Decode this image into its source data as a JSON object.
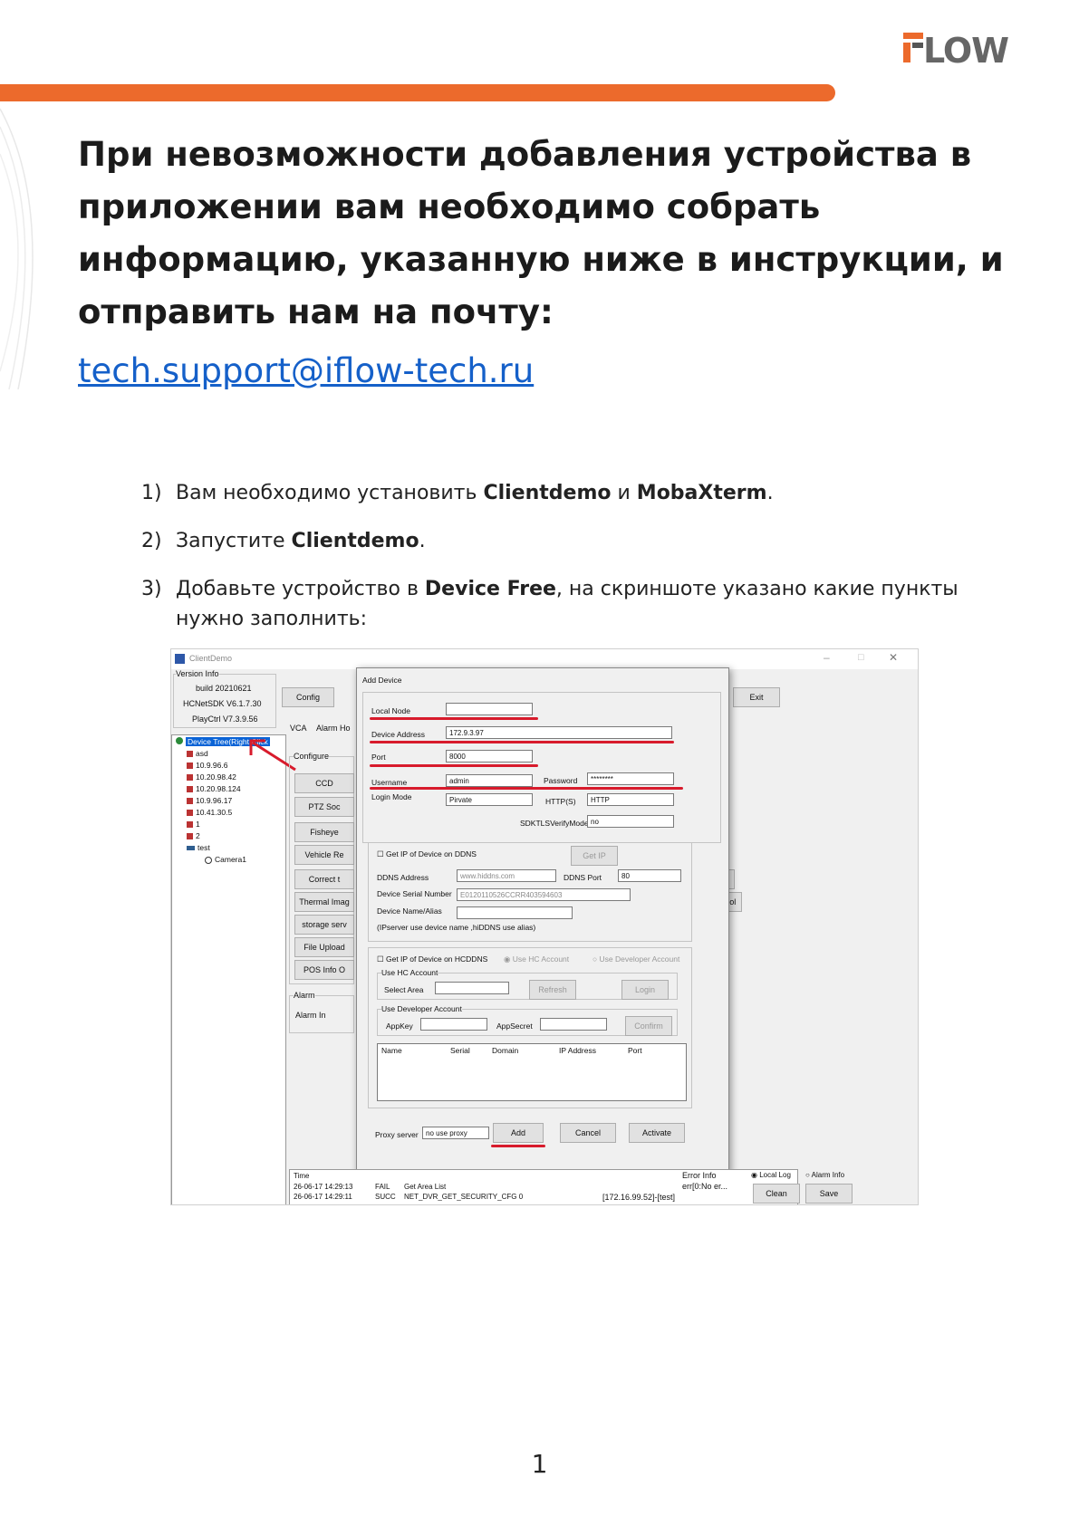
{
  "logo": {
    "text": "IFLOW",
    "color": "#ec6a2c"
  },
  "heading": "При невозможности добавления устройства в приложении вам необходимо собрать информацию, указанную ниже в инструкции, и отправить нам на почту:",
  "email": "tech.support@iflow-tech.ru",
  "steps": [
    {
      "num": "1)",
      "pre": "Вам необходимо установить ",
      "b1": "Clientdemo",
      "mid": " и ",
      "b2": "MobaXterm",
      "post": "."
    },
    {
      "num": "2)",
      "pre": "Запустите ",
      "b1": "Clientdemo",
      "post": "."
    },
    {
      "num": "3)",
      "pre": "Добавьте устройство в ",
      "b1": "Device Free",
      "post": ", на скриншоте указано какие пункты нужно заполнить:"
    }
  ],
  "page_number": "1",
  "screenshot": {
    "window_title": "ClientDemo",
    "version_info": {
      "label": "Version Info",
      "build": "build 20210621",
      "sdk": "HCNetSDK V6.1.7.30",
      "playctrl": "PlayCtrl V7.3.9.56"
    },
    "buttons": {
      "config": "Config",
      "exit": "Exit"
    },
    "tabs": [
      "VCA",
      "Alarm Ho"
    ],
    "tree": {
      "root": "Device Tree(Right Click",
      "items": [
        "asd",
        "10.9.96.6",
        "10.20.98.42",
        "10.20.98.124",
        "10.9.96.17",
        "10.41.30.5",
        "1",
        "2",
        "test"
      ],
      "camera": "Camera1"
    },
    "configure": {
      "label": "Configure",
      "buttons": [
        "CCD",
        "PTZ Soc",
        "Fisheye",
        "Vehicle Re",
        "Correct t",
        "Thermal Imag",
        "storage serv",
        "File Upload",
        "POS Info O"
      ]
    },
    "alarm": {
      "label": "Alarm",
      "alarm_in": "Alarm In"
    },
    "right_partial": [
      "on",
      "ocol"
    ],
    "dialog": {
      "title": "Add Device",
      "local_node": {
        "label": "Local Node",
        "value": ""
      },
      "device_address": {
        "label": "Device Address",
        "value": "172.9.3.97"
      },
      "port": {
        "label": "Port",
        "value": "8000"
      },
      "username": {
        "label": "Username",
        "value": "admin"
      },
      "password": {
        "label": "Password",
        "value": "********"
      },
      "login_mode": {
        "label": "Login Mode",
        "value": "Pirvate"
      },
      "https": {
        "label": "HTTP(S)",
        "value": "HTTP"
      },
      "sdktls": {
        "label": "SDKTLSVerifyMode",
        "value": "no"
      },
      "ddns": {
        "checkbox": "Get IP of Device on DDNS",
        "get_ip": "Get IP",
        "address_label": "DDNS Address",
        "address_value": "www.hiddns.com",
        "port_label": "DDNS Port",
        "port_value": "80",
        "serial_label": "Device Serial Number",
        "serial_value": "E0120110526CCRR403594603",
        "alias_label": "Device Name/Alias",
        "note": "(IPserver use device name ,hiDDNS use alias)"
      },
      "hcddns": {
        "checkbox": "Get IP of Device on HCDDNS",
        "radio_hc": "Use HC Account",
        "radio_dev": "Use Developer Account",
        "hc_group": "Use HC Account",
        "select_area": "Select Area",
        "refresh": "Refresh",
        "login": "Login",
        "dev_group": "Use Developer Account",
        "appkey": "AppKey",
        "appsecret": "AppSecret",
        "confirm": "Confirm",
        "columns": [
          "Name",
          "Serial",
          "Domain",
          "IP Address",
          "Port"
        ]
      },
      "proxy": {
        "label": "Proxy server",
        "value": "no use proxy"
      },
      "add": "Add",
      "cancel": "Cancel",
      "activate": "Activate"
    },
    "log": {
      "columns": [
        "Time",
        "Error Info"
      ],
      "rows": [
        {
          "time": "26-06-17 14:29:13",
          "status": "FAIL",
          "msg": "Get Area List",
          "info": "err[0:No er..."
        },
        {
          "time": "26-06-17 14:29:11",
          "status": "SUCC",
          "msg": "NET_DVR_GET_SECURITY_CFG 0",
          "info": "[172.16.99.52]-[test]"
        }
      ],
      "local_log": "Local Log",
      "alarm_info": "Alarm Info",
      "clean": "Clean",
      "save": "Save"
    }
  }
}
